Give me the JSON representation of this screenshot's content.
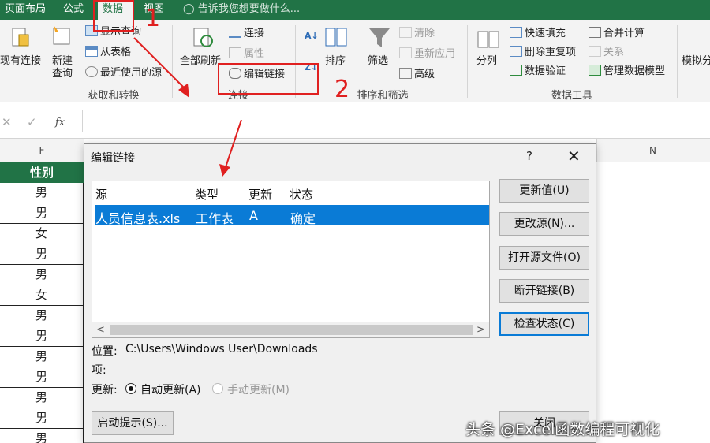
{
  "tabs": [
    "页面布局",
    "公式",
    "数据",
    "视图"
  ],
  "tell_me": "告诉我您想要做什么...",
  "ribbon": {
    "existing_conn": "现有连接",
    "new_query": "新建\n查询",
    "show_query": "显示查询",
    "from_table": "从表格",
    "recent_sources": "最近使用的源",
    "group_get": "获取和转换",
    "refresh_all": "全部刷新",
    "connections": "连接",
    "properties": "属性",
    "edit_links": "编辑链接",
    "group_conn": "连接",
    "sort": "排序",
    "filter": "筛选",
    "clear": "清除",
    "reapply": "重新应用",
    "advanced": "高级",
    "group_sort": "排序和筛选",
    "text_to_col": "分列",
    "flash_fill": "快速填充",
    "remove_dup": "删除重复项",
    "data_valid": "数据验证",
    "consolidate": "合并计算",
    "relationships": "关系",
    "data_model": "管理数据模型",
    "group_tools": "数据工具",
    "what_if": "模拟分"
  },
  "formula_bar": {
    "fx": "fx",
    "cancel": "✕",
    "enter": "✓"
  },
  "sheet": {
    "col_f": "F",
    "col_n": "N",
    "header": "性别",
    "rows": [
      "男",
      "男",
      "女",
      "男",
      "男",
      "女",
      "男",
      "男",
      "男",
      "男",
      "男",
      "男",
      "男"
    ]
  },
  "dialog": {
    "title": "编辑链接",
    "help": "?",
    "close": "✕",
    "columns": [
      "源",
      "类型",
      "更新",
      "状态"
    ],
    "row": [
      "人员信息表.xls",
      "工作表",
      "A",
      "确定"
    ],
    "buttons": [
      "更新值(U)",
      "更改源(N)...",
      "打开源文件(O)",
      "断开链接(B)",
      "检查状态(C)"
    ],
    "close_btn": "关闭",
    "location_label": "位置:",
    "location_value": "C:\\Users\\Windows User\\Downloads",
    "item_label": "项:",
    "update_label": "更新:",
    "auto_update": "自动更新(A)",
    "manual_update": "手动更新(M)",
    "startup_prompt": "启动提示(S)..."
  },
  "annotations": {
    "step1": "1",
    "step2": "2"
  },
  "watermark": "头条 @Excel函数编程可视化",
  "colors": {
    "excel_green": "#217346",
    "selection_blue": "#0a7bd6",
    "annotation_red": "#e02020"
  }
}
